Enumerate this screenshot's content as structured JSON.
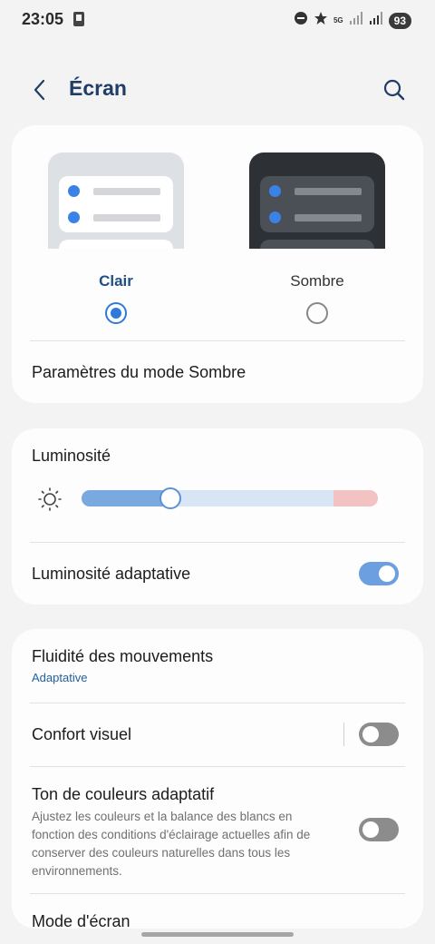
{
  "status_bar": {
    "time": "23:05",
    "network": "5G",
    "battery": "93"
  },
  "header": {
    "title": "Écran",
    "back_icon": "chevron-left-icon",
    "search_icon": "search-icon"
  },
  "theme": {
    "light_label": "Clair",
    "dark_label": "Sombre",
    "selected": "Clair",
    "dark_settings_label": "Paramètres du mode Sombre"
  },
  "brightness": {
    "label": "Luminosité",
    "level": 0.3,
    "adaptive_label": "Luminosité adaptative",
    "adaptive_on": true
  },
  "options": {
    "motion_label": "Fluidité des mouvements",
    "motion_value": "Adaptative",
    "eye_comfort_label": "Confort visuel",
    "eye_comfort_on": false,
    "adaptive_tone_label": "Ton de couleurs adaptatif",
    "adaptive_tone_desc": "Ajustez les couleurs et la balance des blancs en fonction des conditions d'éclairage actuelles afin de conserver des couleurs naturelles dans tous les environnements.",
    "adaptive_tone_on": false,
    "screen_mode_label": "Mode d'écran"
  },
  "colors": {
    "accent": "#2f7ad9",
    "title": "#1f3d66",
    "background": "#f3f3f3",
    "card": "#fdfdfd"
  }
}
